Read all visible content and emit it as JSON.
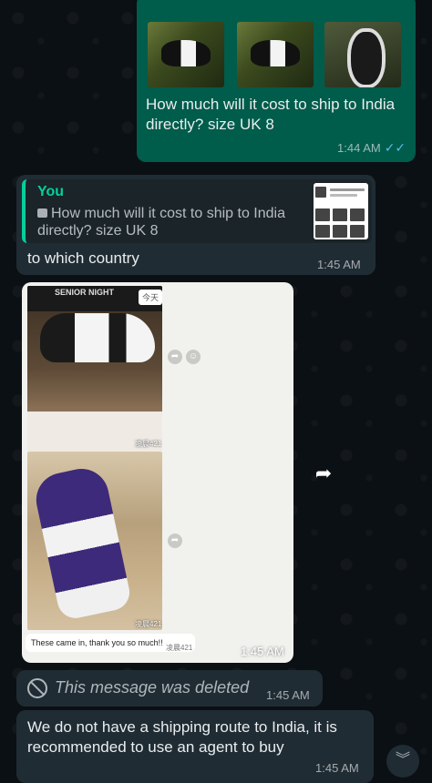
{
  "messages": {
    "outgoing_1": {
      "text": "How much will it cost to ship to India directly? size UK 8",
      "time": "1:44 AM",
      "status_icon": "double-check-read-icon"
    },
    "incoming_reply": {
      "quote_author": "You",
      "quote_text": "How much will it cost to ship to India directly? size UK 8",
      "quote_icon": "photo-icon",
      "text": "to which country",
      "time": "1:45 AM"
    },
    "incoming_image": {
      "tag_today": "今天",
      "shirt_text": "SENIOR NIGHT",
      "watermark": "凌晨421",
      "caption": "These came in, thank you so much!!",
      "time": "1:45 AM"
    },
    "deleted": {
      "text": "This message was deleted",
      "time": "1:45 AM"
    },
    "incoming_last": {
      "text": "We do not have a shipping route to India, it is recommended to use an agent to buy",
      "time": "1:45 AM"
    }
  },
  "icons": {
    "forward": "forward-icon",
    "scroll_down": "chevron-double-down-icon"
  },
  "colors": {
    "outgoing_bubble": "#005c4b",
    "incoming_bubble": "#202c33",
    "read_ticks": "#53bdeb",
    "quote_accent": "#06cf9c"
  }
}
